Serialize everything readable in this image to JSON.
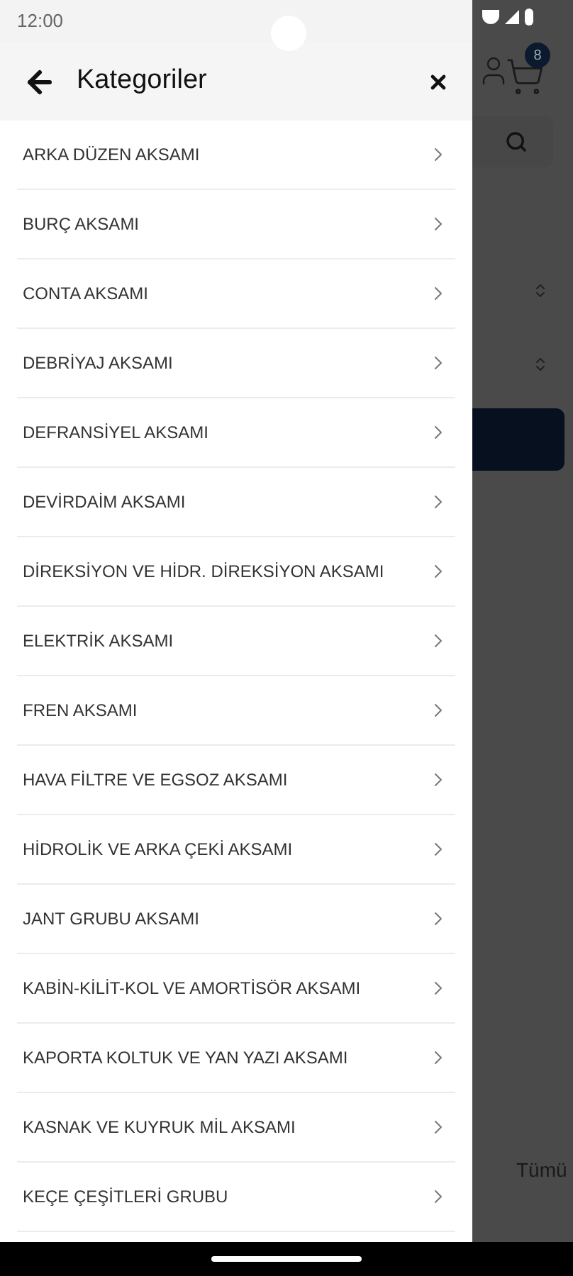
{
  "status_bar": {
    "time": "12:00"
  },
  "drawer": {
    "title": "Kategoriler",
    "items": [
      {
        "label": "ARKA DÜZEN AKSAMI"
      },
      {
        "label": "BURÇ AKSAMI"
      },
      {
        "label": "CONTA AKSAMI"
      },
      {
        "label": "DEBRİYAJ AKSAMI"
      },
      {
        "label": "DEFRANSİYEL AKSAMI"
      },
      {
        "label": "DEVİRDAİM AKSAMI"
      },
      {
        "label": "DİREKSİYON VE HİDR. DİREKSİYON AKSAMI"
      },
      {
        "label": "ELEKTRİK AKSAMI"
      },
      {
        "label": "FREN AKSAMI"
      },
      {
        "label": "HAVA FİLTRE VE EGSOZ AKSAMI"
      },
      {
        "label": "HİDROLİK VE ARKA ÇEKİ AKSAMI"
      },
      {
        "label": "JANT GRUBU AKSAMI"
      },
      {
        "label": "KABİN-KİLİT-KOL VE AMORTİSÖR AKSAMI"
      },
      {
        "label": "KAPORTA KOLTUK VE YAN YAZI AKSAMI"
      },
      {
        "label": "KASNAK VE KUYRUK MİL AKSAMI"
      },
      {
        "label": "KEÇE ÇEŞİTLERİ GRUBU"
      }
    ]
  },
  "background": {
    "cart_count": "8",
    "filter_label": "Tümü"
  }
}
